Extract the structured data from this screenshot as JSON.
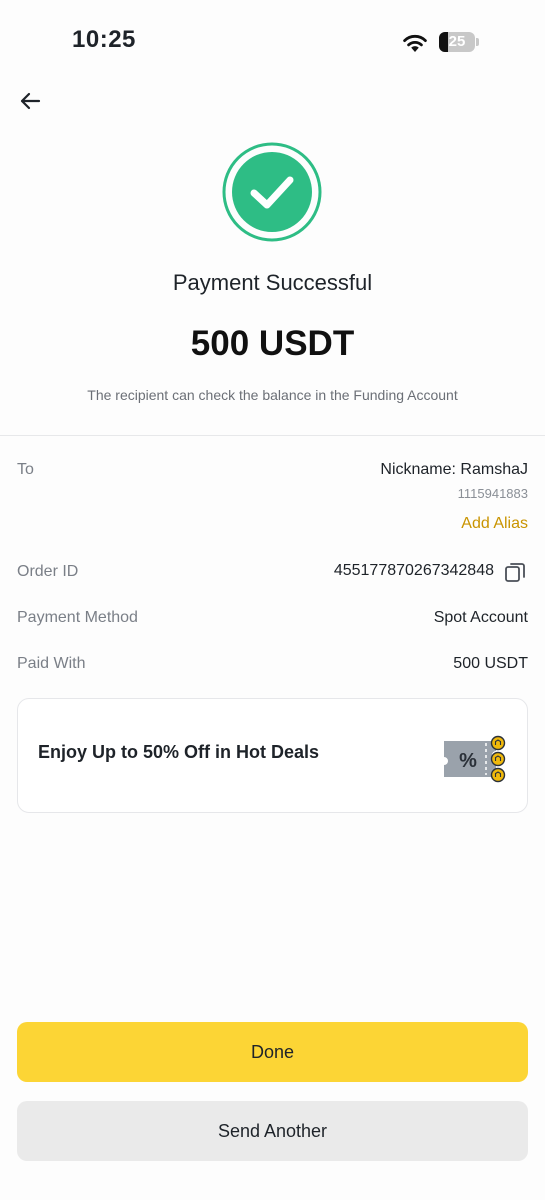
{
  "status_bar": {
    "time": "10:25",
    "battery_level": "25",
    "battery_fraction": 0.25,
    "icons": [
      "wifi-icon",
      "battery-icon"
    ]
  },
  "header": {
    "back_icon": "arrow-left-icon",
    "success_icon": "check-circle-icon",
    "title": "Payment Successful",
    "amount": "500 USDT",
    "subtitle": "The recipient can check the balance in the Funding Account"
  },
  "details": {
    "to": {
      "label": "To",
      "nickname": "Nickname: RamshaJ",
      "uid": "1115941883",
      "add_alias": "Add Alias"
    },
    "order_id": {
      "label": "Order ID",
      "value": "455177870267342848",
      "copy_icon": "copy-icon"
    },
    "payment_method": {
      "label": "Payment Method",
      "value": "Spot Account"
    },
    "paid_with": {
      "label": "Paid With",
      "value": "500 USDT"
    }
  },
  "promo": {
    "text": "Enjoy Up to 50% Off in Hot Deals",
    "icon": "coupon-icon"
  },
  "buttons": {
    "done": "Done",
    "send_another": "Send Another"
  },
  "colors": {
    "success_green": "#2ebd85",
    "accent_yellow": "#fcd535",
    "alias_gold": "#c99400",
    "secondary_button": "#eaeaea"
  }
}
